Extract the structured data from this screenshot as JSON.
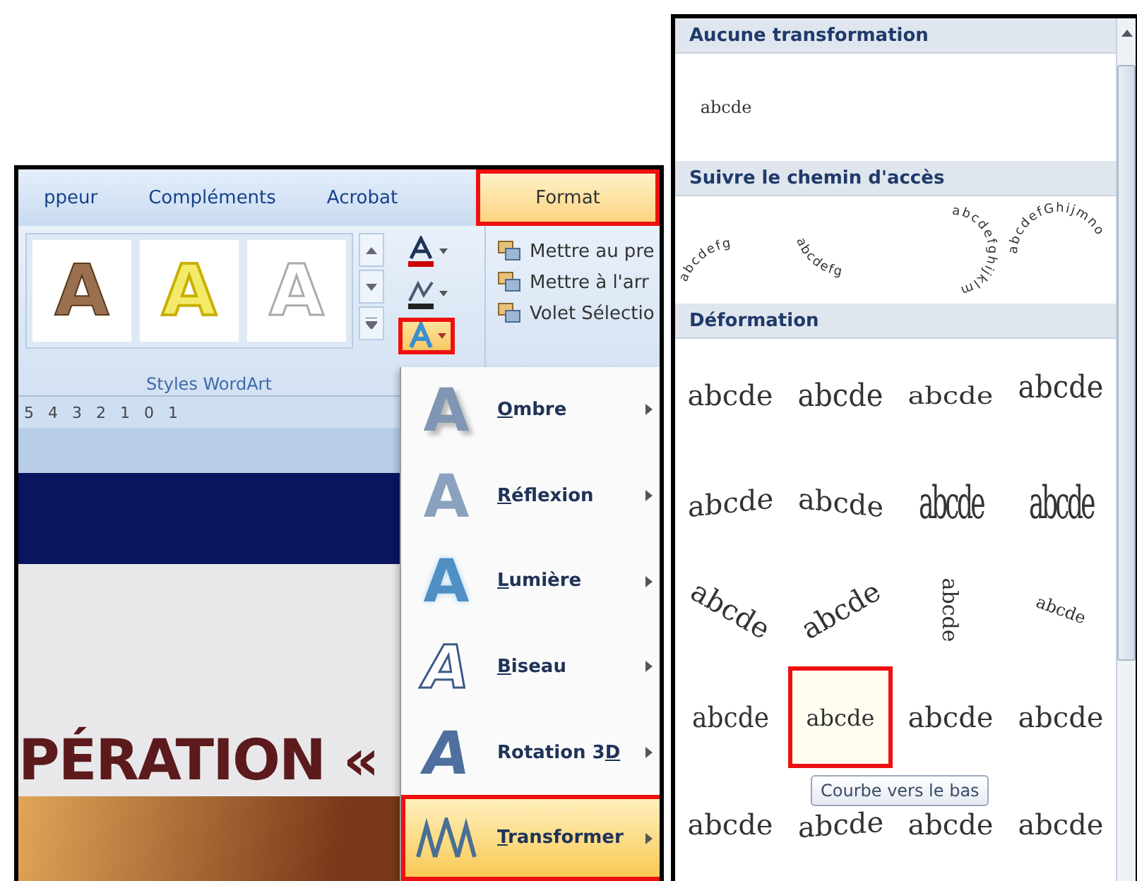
{
  "ribbon": {
    "tabs": [
      {
        "label": "ppeur",
        "selected": false,
        "highlighted": false
      },
      {
        "label": "Compléments",
        "selected": false,
        "highlighted": false
      },
      {
        "label": "Acrobat",
        "selected": false,
        "highlighted": false
      },
      {
        "label": "Format",
        "selected": true,
        "highlighted": true
      }
    ],
    "wordart_styles": [
      {
        "glyph": "A",
        "kind": "tan"
      },
      {
        "glyph": "A",
        "kind": "gold"
      },
      {
        "glyph": "A",
        "kind": "white"
      }
    ],
    "effects_button": {
      "highlighted": true
    },
    "arrange_commands": [
      "Mettre au pre",
      "Mettre à l'arr",
      "Volet Sélectio"
    ],
    "group_label": "Styles WordArt"
  },
  "ruler": [
    "5",
    "4",
    "3",
    "2",
    "1",
    "0",
    "1"
  ],
  "slide": {
    "title": "PÉRATION «"
  },
  "effects_menu": [
    {
      "key": "O",
      "after": "mbre",
      "glyph": "A",
      "kind": "shadow",
      "highlighted": false
    },
    {
      "key": "R",
      "after": "éflexion",
      "glyph": "A",
      "kind": "reflection",
      "highlighted": false
    },
    {
      "key": "L",
      "after": "umière",
      "glyph": "A",
      "kind": "glow",
      "highlighted": false
    },
    {
      "key": "B",
      "after": "iseau",
      "glyph": "A",
      "kind": "bevel",
      "highlighted": false
    },
    {
      "before": "Rotation 3",
      "key": "D",
      "glyph": "A",
      "kind": "rotation",
      "highlighted": false
    },
    {
      "key": "T",
      "after": "ransformer",
      "kind": "transform",
      "highlighted": true
    }
  ],
  "gallery": {
    "no_transform": {
      "title": "Aucune transformation",
      "item": "abcde"
    },
    "follow_path": {
      "title": "Suivre le chemin d'accès",
      "items": [
        {
          "text": "abcdefg",
          "kind": "arch-up"
        },
        {
          "text": "abcdefg",
          "kind": "arch-down"
        },
        {
          "text": "abcdefghijklm",
          "kind": "circle"
        },
        {
          "text": "abcdefGhijmno",
          "kind": "button"
        }
      ]
    },
    "warp": {
      "title": "Déformation",
      "items": [
        {
          "text": "abcde",
          "kind": "plain",
          "selected": false,
          "highlighted": false
        },
        {
          "text": "abcde",
          "kind": "stop",
          "selected": false,
          "highlighted": false
        },
        {
          "text": "abcde",
          "kind": "triangle-up",
          "selected": false,
          "highlighted": false
        },
        {
          "text": "abcde",
          "kind": "triangle-down",
          "selected": false,
          "highlighted": false
        },
        {
          "text": "abcde",
          "kind": "chevron-up",
          "selected": false,
          "highlighted": false
        },
        {
          "text": "abcde",
          "kind": "chevron-down",
          "selected": false,
          "highlighted": false
        },
        {
          "text": "abcde",
          "kind": "ring-inside",
          "selected": false,
          "highlighted": false
        },
        {
          "text": "abcde",
          "kind": "ring-outside",
          "selected": false,
          "highlighted": false
        },
        {
          "text": "abcde",
          "kind": "arch-up",
          "selected": false,
          "highlighted": false
        },
        {
          "text": "abcde",
          "kind": "arch-down",
          "selected": false,
          "highlighted": false
        },
        {
          "text": "abcde",
          "kind": "circle",
          "selected": false,
          "highlighted": false
        },
        {
          "text": "abcde",
          "kind": "button",
          "selected": false,
          "highlighted": false
        },
        {
          "text": "abcde",
          "kind": "curve-up",
          "selected": false,
          "highlighted": false
        },
        {
          "text": "abcde",
          "kind": "curve-down",
          "selected": true,
          "highlighted": true
        },
        {
          "text": "abcde",
          "kind": "can-up",
          "selected": false,
          "highlighted": false
        },
        {
          "text": "abcde",
          "kind": "can-down",
          "selected": false,
          "highlighted": false
        },
        {
          "text": "abcde",
          "kind": "wave",
          "selected": false,
          "highlighted": false
        },
        {
          "text": "abcde",
          "kind": "double-wave",
          "selected": false,
          "highlighted": false
        },
        {
          "text": "abcde",
          "kind": "inflate",
          "selected": false,
          "highlighted": false
        },
        {
          "text": "abcde",
          "kind": "deflate",
          "selected": false,
          "highlighted": false
        }
      ]
    },
    "tooltip": "Courbe vers le bas"
  }
}
